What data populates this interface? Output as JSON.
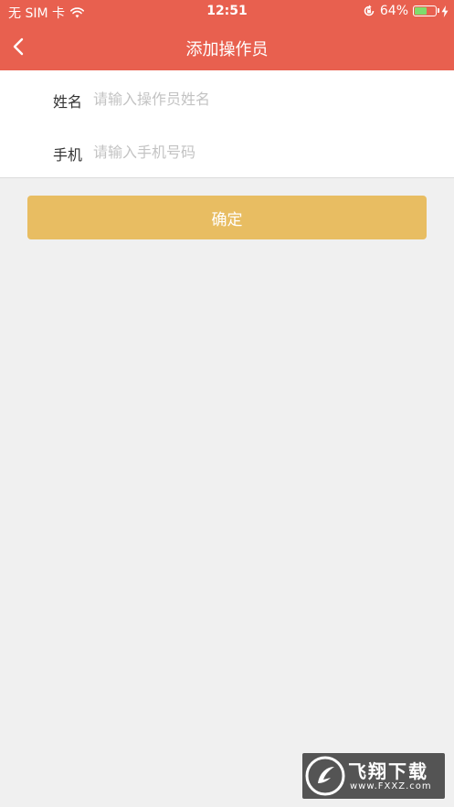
{
  "status_bar": {
    "carrier": "无 SIM 卡",
    "time": "12:51",
    "battery_percent": "64%",
    "battery_level": 0.64,
    "icons": [
      "wifi-icon",
      "orientation-lock-icon",
      "battery-icon",
      "charging-bolt-icon"
    ]
  },
  "nav": {
    "title": "添加操作员",
    "back_icon": "chevron-left-icon"
  },
  "form": {
    "name": {
      "label": "姓名",
      "value": "",
      "placeholder": "请输入操作员姓名"
    },
    "phone": {
      "label": "手机",
      "value": "",
      "placeholder": "请输入手机号码"
    }
  },
  "confirm_label": "确定",
  "watermark": {
    "text": "飞翔下载",
    "url": "www.FXXZ.com"
  },
  "colors": {
    "header": "#e8604f",
    "button": "#e8bd62",
    "background": "#f0f0f0",
    "placeholder": "#c3c3c3"
  }
}
